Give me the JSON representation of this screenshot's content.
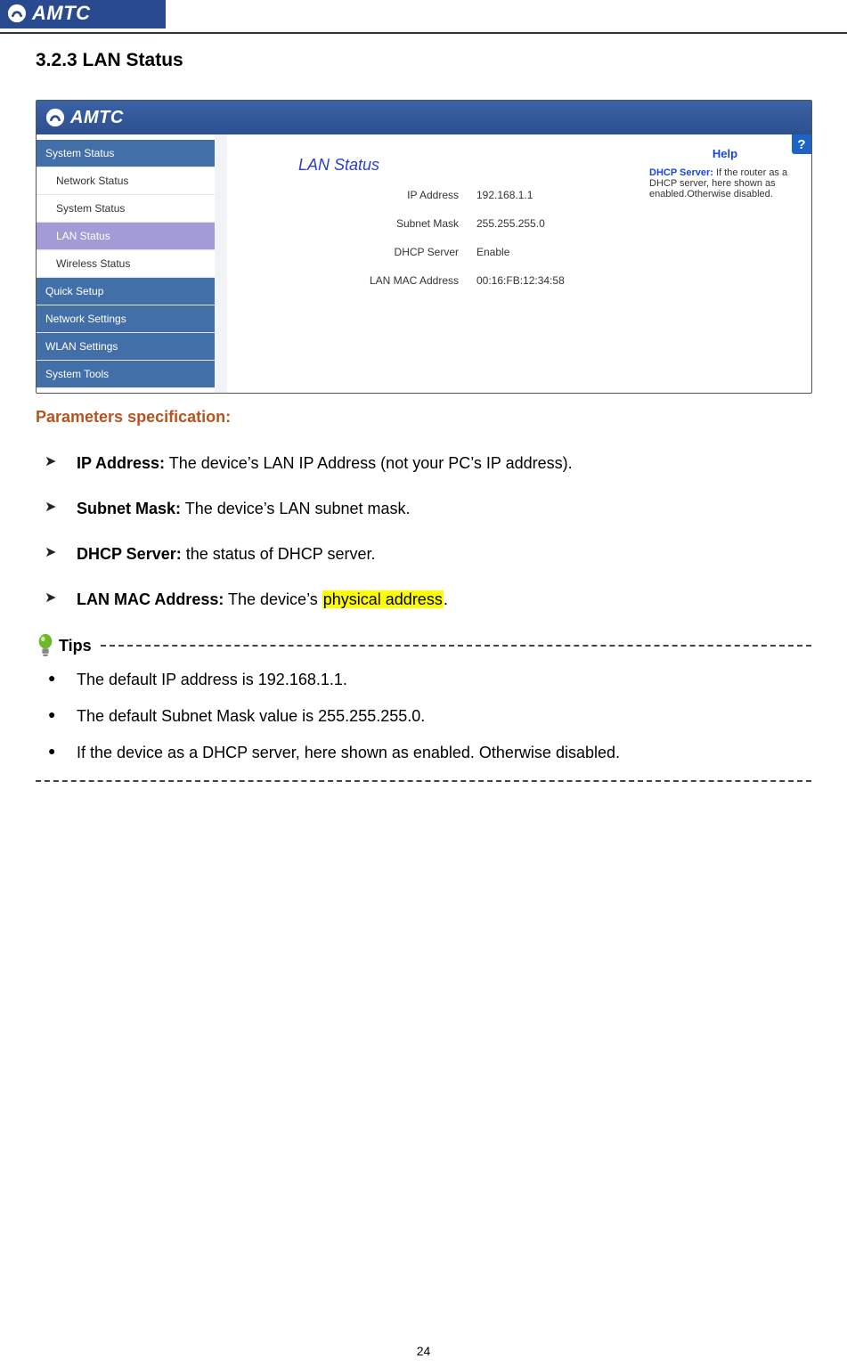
{
  "brand": "AMTC",
  "section_heading": "3.2.3 LAN Status",
  "screenshot": {
    "titlebar_brand": "AMTC",
    "sidebar": [
      {
        "label": "System Status",
        "class": "sb-top"
      },
      {
        "label": "Network Status",
        "class": "sb-sub"
      },
      {
        "label": "System Status",
        "class": "sb-sub"
      },
      {
        "label": "LAN Status",
        "class": "sb-sub sb-active"
      },
      {
        "label": "Wireless Status",
        "class": "sb-sub"
      },
      {
        "label": "Quick Setup",
        "class": "sb-cat"
      },
      {
        "label": "Network Settings",
        "class": "sb-cat"
      },
      {
        "label": "WLAN Settings",
        "class": "sb-cat"
      },
      {
        "label": "System Tools",
        "class": "sb-cat"
      }
    ],
    "center_title": "LAN Status",
    "rows": [
      {
        "label": "IP Address",
        "value": "192.168.1.1"
      },
      {
        "label": "Subnet Mask",
        "value": "255.255.255.0"
      },
      {
        "label": "DHCP Server",
        "value": "Enable"
      },
      {
        "label": "LAN MAC Address",
        "value": "00:16:FB:12:34:58"
      }
    ],
    "help": {
      "title": "Help",
      "bold": "DHCP Server:",
      "text": " If the router as a DHCP server, here shown as enabled.Otherwise disabled.",
      "qmark": "?"
    }
  },
  "params_title": "Parameters specification:",
  "params": [
    {
      "term": "IP Address:",
      "desc": " The device’s LAN IP Address (not your PC’s IP address)."
    },
    {
      "term": "Subnet Mask:",
      "desc": " The device’s LAN subnet mask."
    },
    {
      "term": "DHCP Server:",
      "desc": " the status of DHCP server."
    },
    {
      "term": "LAN MAC Address:",
      "desc_pre": " The device’s ",
      "desc_hl": "physical address",
      "desc_post": "."
    }
  ],
  "tips_label": "Tips",
  "tips": [
    "The default IP address is 192.168.1.1.",
    "The default Subnet Mask value is 255.255.255.0.",
    "If the device as a DHCP server, here shown as enabled. Otherwise disabled."
  ],
  "page_number": "24"
}
